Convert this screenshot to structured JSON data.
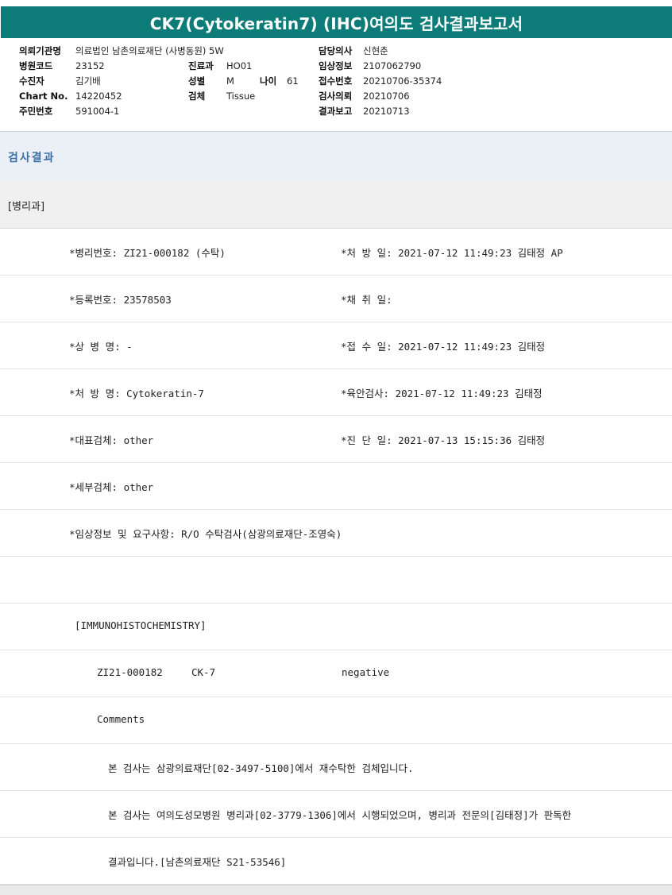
{
  "report": {
    "title": "CK7(Cytokeratin7) (IHC)여의도 검사결과보고서"
  },
  "patient": {
    "institution_label": "의뢰기관명",
    "institution_value": "의료법인 남촌의료재단 (사병동원) 5W",
    "hospital_code_label": "병원코드",
    "hospital_code_value": "23152",
    "examinee_label": "수진자",
    "examinee_value": "김기배",
    "chart_label": "Chart No.",
    "chart_value": "14220452",
    "resident_label": "주민번호",
    "resident_value": "591004-1",
    "dept_label": "진료과",
    "dept_value": "HO01",
    "sex_label": "성별",
    "sex_value": "M",
    "age_label": "나이",
    "age_value": "61",
    "specimen_label": "검체",
    "specimen_value": "Tissue",
    "doctor_label": "담당의사",
    "doctor_value": "신현춘",
    "clinical_label": "임상정보",
    "clinical_value": "2107062790",
    "receipt_label": "접수번호",
    "receipt_value": "20210706-35374",
    "request_label": "검사의뢰",
    "request_value": "20210706",
    "report_label": "결과보고",
    "report_value": "20210713"
  },
  "sections": {
    "results": "검사결과",
    "department": "[병리과]"
  },
  "details": {
    "pathology_no": "*병리번호: ZI21-000182 (수탁)",
    "prescription_date": "*처 방 일: 2021-07-12 11:49:23  김태정 AP",
    "registration_no": "*등록번호: 23578503",
    "collection_date": "*채 취 일:",
    "disease_name": "*상 병 명: -",
    "reception_date": "*접 수 일: 2021-07-12 11:49:23  김태정",
    "prescription_name": "*처 방 명: Cytokeratin-7",
    "gross_exam": "*육안검사: 2021-07-12 11:49:23  김태정",
    "main_specimen": "*대표검체: other",
    "diagnosis_date": "*진 단 일: 2021-07-13 15:15:36  김태정",
    "sub_specimen": "*세부검체: other",
    "clinical_request": "*임상정보 및 요구사항: R/O 수탁검사(삼광의료재단-조영숙)"
  },
  "ihc": {
    "header": "[IMMUNOHISTOCHEMISTRY]",
    "result_id": "ZI21-000182",
    "result_marker": "CK-7",
    "result_value": "negative",
    "comments_label": "Comments",
    "comment_1": "본 검사는 삼광의료재단[02-3497-5100]에서 재수탁한 검체입니다.",
    "comment_2": "본 검사는 여의도성모병원 병리과[02-3779-1306]에서 시행되었으며, 병리과 전문의[김태정]가 판독한",
    "comment_3": "결과입니다.[남촌의료재단 S21-53546]"
  }
}
